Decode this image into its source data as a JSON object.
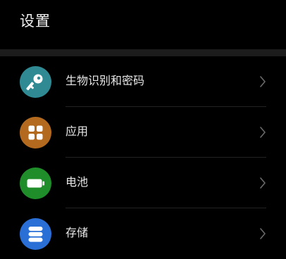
{
  "header": {
    "title": "设置"
  },
  "items": [
    {
      "label": "生物识别和密码",
      "icon": "key-icon",
      "color": "#2f8a94"
    },
    {
      "label": "应用",
      "icon": "apps-grid-icon",
      "color": "#b36a1f"
    },
    {
      "label": "电池",
      "icon": "battery-icon",
      "color": "#1f8e2a"
    },
    {
      "label": "存储",
      "icon": "storage-icon",
      "color": "#2a6fd6"
    }
  ]
}
